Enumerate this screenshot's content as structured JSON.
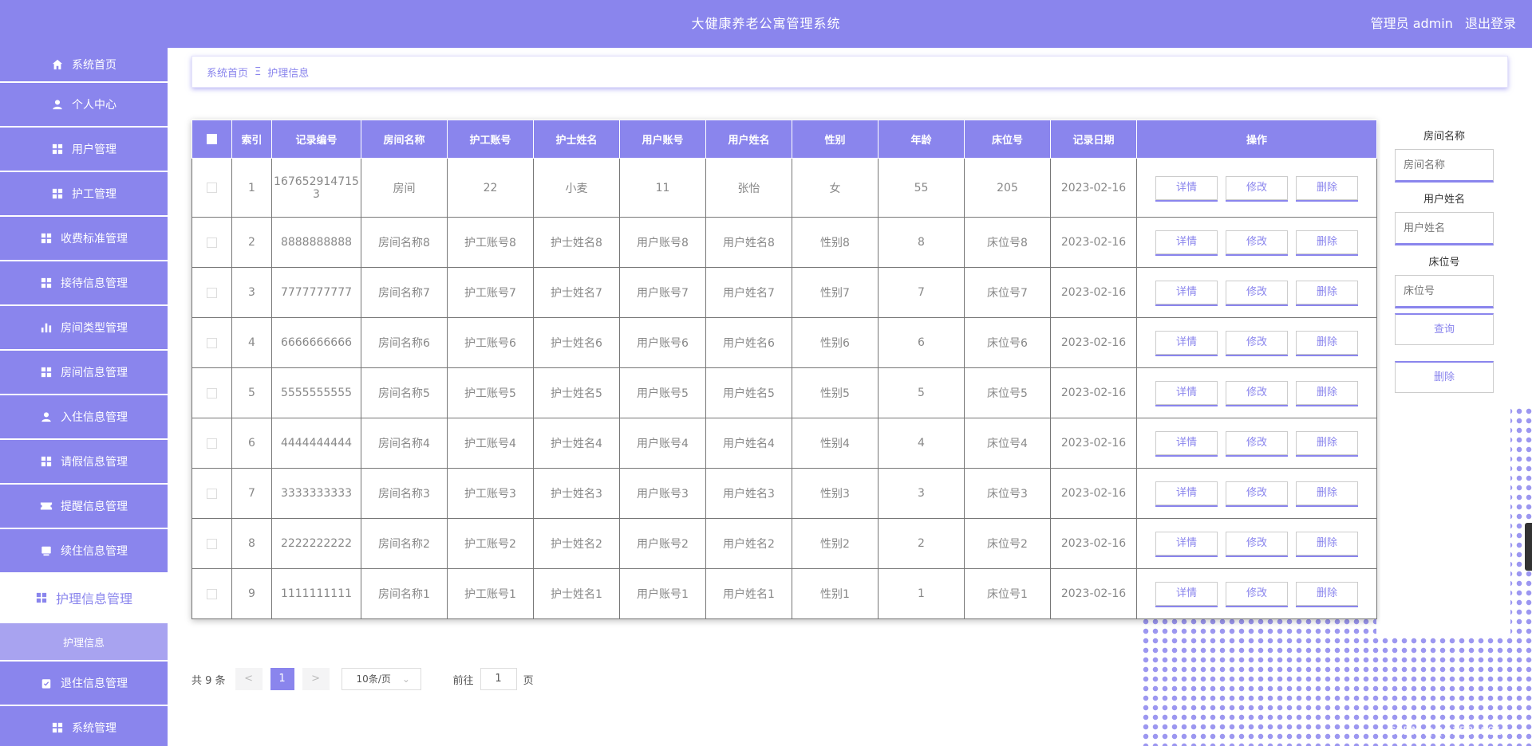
{
  "header": {
    "title": "大健康养老公寓管理系统",
    "user_label": "管理员 admin",
    "logout_label": "退出登录"
  },
  "sidebar": {
    "items": [
      {
        "label": "系统首页",
        "icon": "home-icon"
      },
      {
        "label": "个人中心",
        "icon": "person-icon"
      },
      {
        "label": "用户管理",
        "icon": "grid-icon"
      },
      {
        "label": "护工管理",
        "icon": "grid-icon"
      },
      {
        "label": "收费标准管理",
        "icon": "grid-icon"
      },
      {
        "label": "接待信息管理",
        "icon": "grid-icon"
      },
      {
        "label": "房间类型管理",
        "icon": "bar-chart-icon"
      },
      {
        "label": "房间信息管理",
        "icon": "grid-icon"
      },
      {
        "label": "入住信息管理",
        "icon": "person-icon"
      },
      {
        "label": "请假信息管理",
        "icon": "grid-icon"
      },
      {
        "label": "提醒信息管理",
        "icon": "ticket-icon"
      },
      {
        "label": "续住信息管理",
        "icon": "box-icon"
      },
      {
        "label": "护理信息管理",
        "icon": "grid-icon"
      },
      {
        "label": "退住信息管理",
        "icon": "clipboard-icon"
      },
      {
        "label": "系统管理",
        "icon": "grid-icon"
      }
    ],
    "active_submenu": "护理信息"
  },
  "breadcrumb": {
    "home": "系统首页",
    "separator": "Ξ",
    "current": "护理信息"
  },
  "table": {
    "headers": [
      "索引",
      "记录编号",
      "房间名称",
      "护工账号",
      "护士姓名",
      "用户账号",
      "用户姓名",
      "性别",
      "年龄",
      "床位号",
      "记录日期",
      "操作"
    ],
    "rows": [
      [
        "1",
        "1676529147153",
        "房间",
        "22",
        "小麦",
        "11",
        "张怡",
        "女",
        "55",
        "205",
        "2023-02-16"
      ],
      [
        "2",
        "8888888888",
        "房间名称8",
        "护工账号8",
        "护士姓名8",
        "用户账号8",
        "用户姓名8",
        "性别8",
        "8",
        "床位号8",
        "2023-02-16"
      ],
      [
        "3",
        "7777777777",
        "房间名称7",
        "护工账号7",
        "护士姓名7",
        "用户账号7",
        "用户姓名7",
        "性别7",
        "7",
        "床位号7",
        "2023-02-16"
      ],
      [
        "4",
        "6666666666",
        "房间名称6",
        "护工账号6",
        "护士姓名6",
        "用户账号6",
        "用户姓名6",
        "性别6",
        "6",
        "床位号6",
        "2023-02-16"
      ],
      [
        "5",
        "5555555555",
        "房间名称5",
        "护工账号5",
        "护士姓名5",
        "用户账号5",
        "用户姓名5",
        "性别5",
        "5",
        "床位号5",
        "2023-02-16"
      ],
      [
        "6",
        "4444444444",
        "房间名称4",
        "护工账号4",
        "护士姓名4",
        "用户账号4",
        "用户姓名4",
        "性别4",
        "4",
        "床位号4",
        "2023-02-16"
      ],
      [
        "7",
        "3333333333",
        "房间名称3",
        "护工账号3",
        "护士姓名3",
        "用户账号3",
        "用户姓名3",
        "性别3",
        "3",
        "床位号3",
        "2023-02-16"
      ],
      [
        "8",
        "2222222222",
        "房间名称2",
        "护工账号2",
        "护士姓名2",
        "用户账号2",
        "用户姓名2",
        "性别2",
        "2",
        "床位号2",
        "2023-02-16"
      ],
      [
        "9",
        "1111111111",
        "房间名称1",
        "护工账号1",
        "护士姓名1",
        "用户账号1",
        "用户姓名1",
        "性别1",
        "1",
        "床位号1",
        "2023-02-16"
      ]
    ],
    "actions": {
      "detail": "详情",
      "edit": "修改",
      "delete": "删除"
    }
  },
  "search": {
    "room_label": "房间名称",
    "room_placeholder": "房间名称",
    "user_label": "用户姓名",
    "user_placeholder": "用户姓名",
    "bed_label": "床位号",
    "bed_placeholder": "床位号",
    "query_button": "查询",
    "delete_button": "删除"
  },
  "pagination": {
    "total_text": "共 9 条",
    "prev": "<",
    "current_page": "1",
    "next": ">",
    "page_size": "10条/页",
    "goto_label": "前往",
    "goto_value": "1",
    "page_suffix": "页"
  },
  "watermark": "CSDN @QQ353598174",
  "colors": {
    "accent": "#8a85ed",
    "submenu": "#a8a3f0"
  }
}
